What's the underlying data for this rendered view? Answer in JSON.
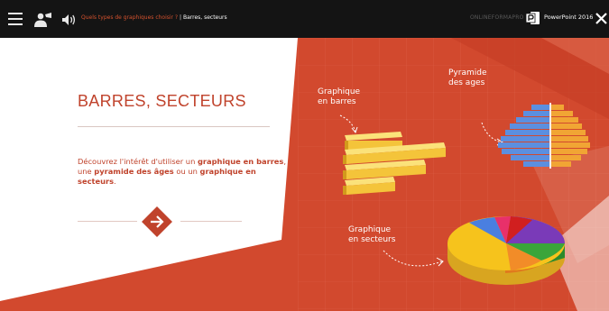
{
  "topbar": {
    "breadcrumb_previous": "Quels types de graphiques choisir ?",
    "breadcrumb_separator": " | ",
    "breadcrumb_current": "Barres, secteurs",
    "brand": "ONLINEFORMAPRO",
    "product": "PowerPoint 2016"
  },
  "icons": [
    "menu-icon",
    "user-icon",
    "audio-icon",
    "powerpoint-icon",
    "close-icon",
    "arrow-right-icon"
  ],
  "slide": {
    "title": "BARRES, SECTEURS",
    "description_part1": "Découvrez l'intérêt d'utiliser un ",
    "description_bold1": "graphique en barres",
    "description_part2": ", une ",
    "description_bold2": "pyramide des âges",
    "description_part3": " ou un ",
    "description_bold3": "graphique en secteurs",
    "description_part4": ".",
    "label_bars_line1": "Graphique",
    "label_bars_line2": "en barres",
    "label_pyramid_line1": "Pyramide",
    "label_pyramid_line2": "des ages",
    "label_pie_line1": "Graphique",
    "label_pie_line2": "en secteurs"
  },
  "colors": {
    "accent": "#c0432c",
    "background_red": "#d2492e",
    "topbar": "#141414",
    "bar_yellow": "#f4c43a",
    "pyramid_blue": "#5b8fe0",
    "pyramid_orange": "#f1a534"
  }
}
